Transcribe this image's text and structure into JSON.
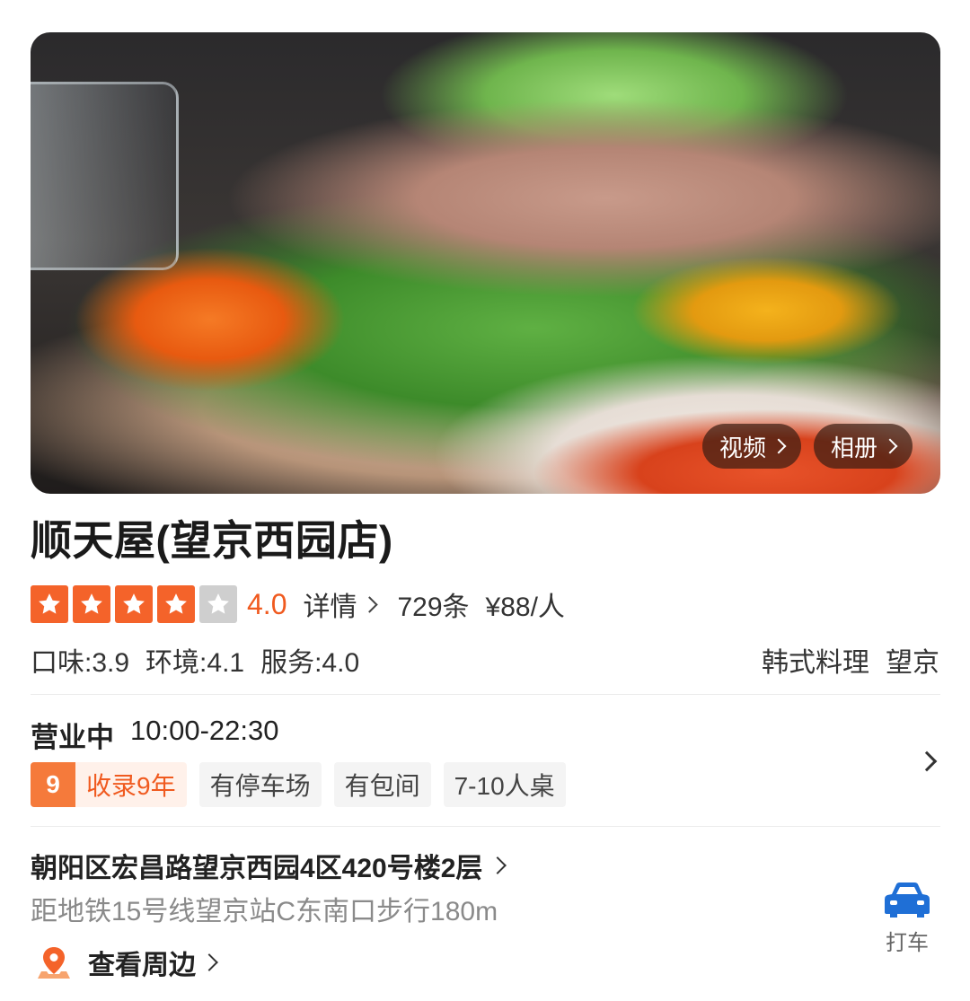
{
  "hero": {
    "video_label": "视频",
    "album_label": "相册"
  },
  "shop": {
    "name": "顺天屋(望京西园店)",
    "stars_filled": 4,
    "stars_total": 5,
    "score": "4.0",
    "detail_label": "详情",
    "reviews": "729条",
    "price": "¥88/人",
    "subscores": {
      "taste": "口味:3.9",
      "environment": "环境:4.1",
      "service": "服务:4.0"
    },
    "cuisine": "韩式料理",
    "area": "望京"
  },
  "hours": {
    "status": "营业中",
    "time": "10:00-22:30"
  },
  "tags": {
    "years_num": "9",
    "years_label": "收录9年",
    "items": [
      "有停车场",
      "有包间",
      "7-10人桌"
    ]
  },
  "location": {
    "address": "朝阳区宏昌路望京西园4区420号楼2层",
    "subway": "距地铁15号线望京站C东南口步行180m",
    "nearby_label": "查看周边",
    "taxi_label": "打车"
  },
  "colors": {
    "accent": "#f4632a",
    "score": "#f05a1f",
    "taxi": "#1f6fd6"
  },
  "icons": [
    "star-icon",
    "chevron-right-icon",
    "location-pin-icon",
    "car-icon"
  ]
}
